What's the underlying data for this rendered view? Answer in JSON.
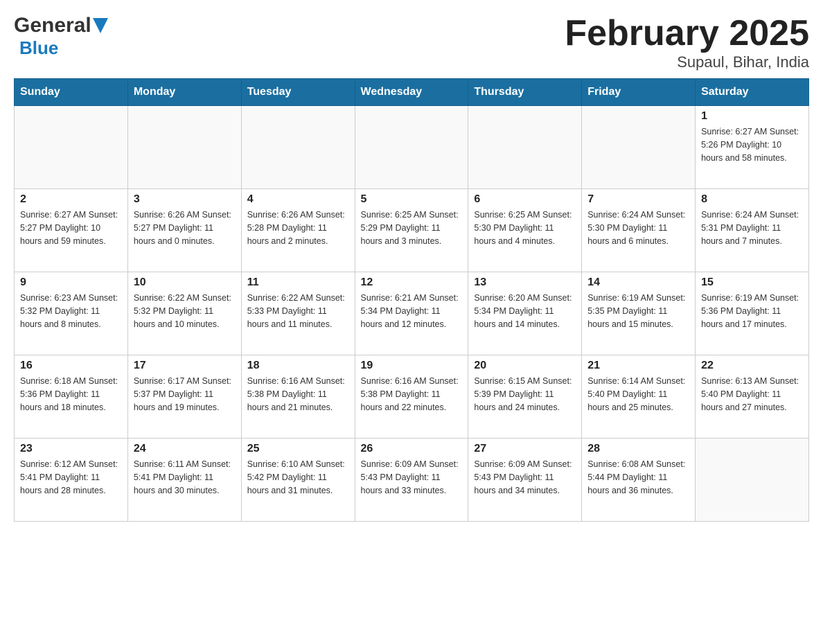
{
  "logo": {
    "general": "General",
    "blue": "Blue"
  },
  "title": "February 2025",
  "subtitle": "Supaul, Bihar, India",
  "weekdays": [
    "Sunday",
    "Monday",
    "Tuesday",
    "Wednesday",
    "Thursday",
    "Friday",
    "Saturday"
  ],
  "weeks": [
    [
      {
        "day": "",
        "info": ""
      },
      {
        "day": "",
        "info": ""
      },
      {
        "day": "",
        "info": ""
      },
      {
        "day": "",
        "info": ""
      },
      {
        "day": "",
        "info": ""
      },
      {
        "day": "",
        "info": ""
      },
      {
        "day": "1",
        "info": "Sunrise: 6:27 AM\nSunset: 5:26 PM\nDaylight: 10 hours\nand 58 minutes."
      }
    ],
    [
      {
        "day": "2",
        "info": "Sunrise: 6:27 AM\nSunset: 5:27 PM\nDaylight: 10 hours\nand 59 minutes."
      },
      {
        "day": "3",
        "info": "Sunrise: 6:26 AM\nSunset: 5:27 PM\nDaylight: 11 hours\nand 0 minutes."
      },
      {
        "day": "4",
        "info": "Sunrise: 6:26 AM\nSunset: 5:28 PM\nDaylight: 11 hours\nand 2 minutes."
      },
      {
        "day": "5",
        "info": "Sunrise: 6:25 AM\nSunset: 5:29 PM\nDaylight: 11 hours\nand 3 minutes."
      },
      {
        "day": "6",
        "info": "Sunrise: 6:25 AM\nSunset: 5:30 PM\nDaylight: 11 hours\nand 4 minutes."
      },
      {
        "day": "7",
        "info": "Sunrise: 6:24 AM\nSunset: 5:30 PM\nDaylight: 11 hours\nand 6 minutes."
      },
      {
        "day": "8",
        "info": "Sunrise: 6:24 AM\nSunset: 5:31 PM\nDaylight: 11 hours\nand 7 minutes."
      }
    ],
    [
      {
        "day": "9",
        "info": "Sunrise: 6:23 AM\nSunset: 5:32 PM\nDaylight: 11 hours\nand 8 minutes."
      },
      {
        "day": "10",
        "info": "Sunrise: 6:22 AM\nSunset: 5:32 PM\nDaylight: 11 hours\nand 10 minutes."
      },
      {
        "day": "11",
        "info": "Sunrise: 6:22 AM\nSunset: 5:33 PM\nDaylight: 11 hours\nand 11 minutes."
      },
      {
        "day": "12",
        "info": "Sunrise: 6:21 AM\nSunset: 5:34 PM\nDaylight: 11 hours\nand 12 minutes."
      },
      {
        "day": "13",
        "info": "Sunrise: 6:20 AM\nSunset: 5:34 PM\nDaylight: 11 hours\nand 14 minutes."
      },
      {
        "day": "14",
        "info": "Sunrise: 6:19 AM\nSunset: 5:35 PM\nDaylight: 11 hours\nand 15 minutes."
      },
      {
        "day": "15",
        "info": "Sunrise: 6:19 AM\nSunset: 5:36 PM\nDaylight: 11 hours\nand 17 minutes."
      }
    ],
    [
      {
        "day": "16",
        "info": "Sunrise: 6:18 AM\nSunset: 5:36 PM\nDaylight: 11 hours\nand 18 minutes."
      },
      {
        "day": "17",
        "info": "Sunrise: 6:17 AM\nSunset: 5:37 PM\nDaylight: 11 hours\nand 19 minutes."
      },
      {
        "day": "18",
        "info": "Sunrise: 6:16 AM\nSunset: 5:38 PM\nDaylight: 11 hours\nand 21 minutes."
      },
      {
        "day": "19",
        "info": "Sunrise: 6:16 AM\nSunset: 5:38 PM\nDaylight: 11 hours\nand 22 minutes."
      },
      {
        "day": "20",
        "info": "Sunrise: 6:15 AM\nSunset: 5:39 PM\nDaylight: 11 hours\nand 24 minutes."
      },
      {
        "day": "21",
        "info": "Sunrise: 6:14 AM\nSunset: 5:40 PM\nDaylight: 11 hours\nand 25 minutes."
      },
      {
        "day": "22",
        "info": "Sunrise: 6:13 AM\nSunset: 5:40 PM\nDaylight: 11 hours\nand 27 minutes."
      }
    ],
    [
      {
        "day": "23",
        "info": "Sunrise: 6:12 AM\nSunset: 5:41 PM\nDaylight: 11 hours\nand 28 minutes."
      },
      {
        "day": "24",
        "info": "Sunrise: 6:11 AM\nSunset: 5:41 PM\nDaylight: 11 hours\nand 30 minutes."
      },
      {
        "day": "25",
        "info": "Sunrise: 6:10 AM\nSunset: 5:42 PM\nDaylight: 11 hours\nand 31 minutes."
      },
      {
        "day": "26",
        "info": "Sunrise: 6:09 AM\nSunset: 5:43 PM\nDaylight: 11 hours\nand 33 minutes."
      },
      {
        "day": "27",
        "info": "Sunrise: 6:09 AM\nSunset: 5:43 PM\nDaylight: 11 hours\nand 34 minutes."
      },
      {
        "day": "28",
        "info": "Sunrise: 6:08 AM\nSunset: 5:44 PM\nDaylight: 11 hours\nand 36 minutes."
      },
      {
        "day": "",
        "info": ""
      }
    ]
  ]
}
